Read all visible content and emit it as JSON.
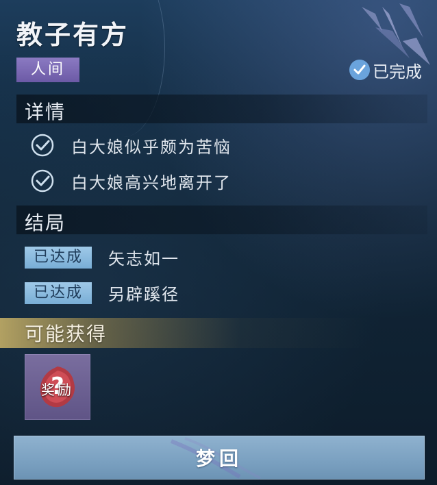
{
  "header": {
    "title": "教子有方",
    "realm_tag": "人间",
    "status_label": "已完成"
  },
  "details": {
    "title": "详情",
    "items": [
      {
        "text": "白大娘似乎颇为苦恼",
        "checked": true
      },
      {
        "text": "白大娘高兴地离开了",
        "checked": true
      }
    ]
  },
  "endings": {
    "title": "结局",
    "items": [
      {
        "badge": "已达成",
        "text": "矢志如一"
      },
      {
        "badge": "已达成",
        "text": "另辟蹊径"
      }
    ]
  },
  "rewards": {
    "title": "可能获得",
    "items": [
      {
        "label": "奖励",
        "icon": "question-mark-icon"
      }
    ]
  },
  "actions": {
    "dream_button": "梦回"
  },
  "colors": {
    "realm_tag": "#7767b3",
    "status_check": "#6aa3dc",
    "ending_badge": "#8bbbe0",
    "button": "#7fa4c4"
  }
}
